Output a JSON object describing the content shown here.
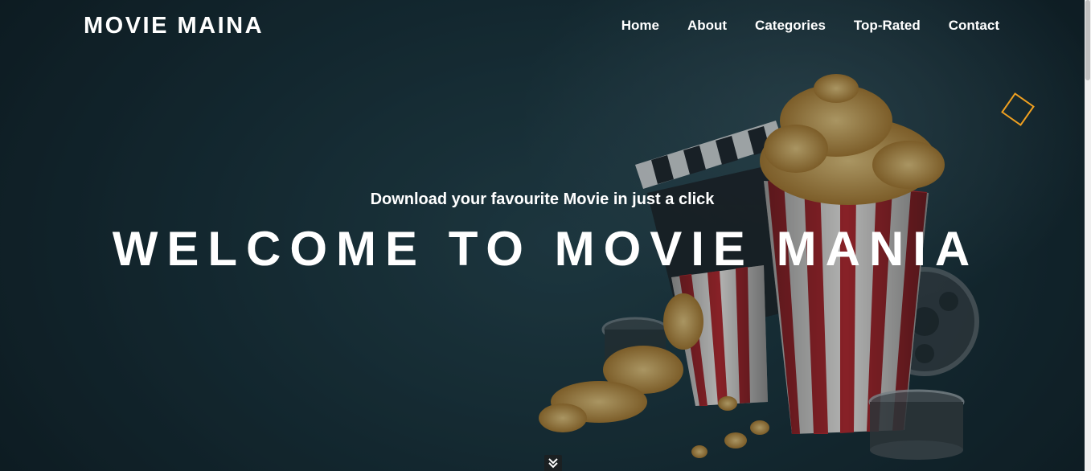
{
  "header": {
    "brand": "MOVIE MAINA",
    "nav": [
      "Home",
      "About",
      "Categories",
      "Top-Rated",
      "Contact"
    ]
  },
  "hero": {
    "tagline": "Download your favourite Movie in just a click",
    "headline": "WELCOME TO MOVIE MANIA",
    "background_image": "popcorn-clapperboard-film-reel",
    "scroll_icon": "double-chevron-down-icon"
  },
  "colors": {
    "background": "#183139",
    "text": "#ffffff",
    "accent": "#f0a020"
  }
}
